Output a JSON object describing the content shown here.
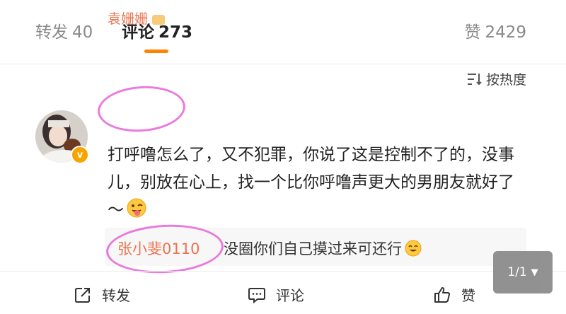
{
  "tabs": [
    {
      "label": "转发",
      "count": "40"
    },
    {
      "label": "评论",
      "count": "273"
    },
    {
      "label": "赞",
      "count": "2429"
    }
  ],
  "sort": {
    "label": "按热度",
    "icon": "sort-icon"
  },
  "comment": {
    "username": "袁姗姗",
    "avatar_badge": "v",
    "text": "打呼噜怎么了，又不犯罪，你说了这是控制不了的，没事儿，别放在心上，找一个比你呼噜声更大的男朋友就好了～",
    "emoji": "tongue-wink-emoji",
    "reply": {
      "username": "张小斐0110",
      "text": "没圈你们自己摸过来可还行",
      "emoji": "smile-emoji"
    }
  },
  "actions": {
    "repost_label": "转发",
    "comment_label": "评论",
    "like_label": "赞"
  },
  "pager": {
    "label": "1/1",
    "caret": "▼"
  },
  "colors": {
    "accent": "#ff8200",
    "username": "#eb7350",
    "highlight_circle": "#e34fd0"
  }
}
